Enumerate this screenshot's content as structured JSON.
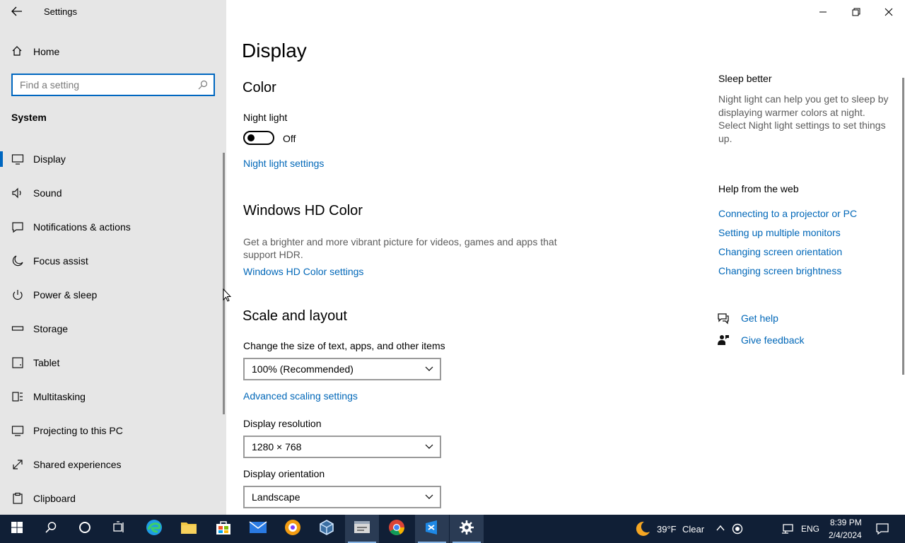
{
  "window": {
    "title": "Settings",
    "minimize_icon": "minimize-icon",
    "maximize_icon": "restore-icon",
    "close_icon": "close-icon"
  },
  "sidebar": {
    "home_label": "Home",
    "search_placeholder": "Find a setting",
    "section": "System",
    "items": [
      {
        "label": "Display",
        "icon": "monitor-icon",
        "selected": true
      },
      {
        "label": "Sound",
        "icon": "speaker-icon"
      },
      {
        "label": "Notifications & actions",
        "icon": "notification-icon"
      },
      {
        "label": "Focus assist",
        "icon": "moon-icon"
      },
      {
        "label": "Power & sleep",
        "icon": "power-icon"
      },
      {
        "label": "Storage",
        "icon": "storage-icon"
      },
      {
        "label": "Tablet",
        "icon": "tablet-icon"
      },
      {
        "label": "Multitasking",
        "icon": "multitasking-icon"
      },
      {
        "label": "Projecting to this PC",
        "icon": "projecting-icon"
      },
      {
        "label": "Shared experiences",
        "icon": "shared-icon"
      },
      {
        "label": "Clipboard",
        "icon": "clipboard-icon"
      }
    ]
  },
  "main": {
    "page_title": "Display",
    "color": {
      "heading": "Color",
      "night_light_label": "Night light",
      "night_light_state": "Off",
      "night_light_settings_link": "Night light settings"
    },
    "hd_color": {
      "heading": "Windows HD Color",
      "description": "Get a brighter and more vibrant picture for videos, games and apps that support HDR.",
      "settings_link": "Windows HD Color settings"
    },
    "scale_layout": {
      "heading": "Scale and layout",
      "size_label": "Change the size of text, apps, and other items",
      "size_value": "100% (Recommended)",
      "advanced_link": "Advanced scaling settings",
      "resolution_label": "Display resolution",
      "resolution_value": "1280 × 768",
      "orientation_label": "Display orientation",
      "orientation_value": "Landscape"
    }
  },
  "right_panel": {
    "sleep_heading": "Sleep better",
    "sleep_text": "Night light can help you get to sleep by displaying warmer colors at night. Select Night light settings to set things up.",
    "help_heading": "Help from the web",
    "help_links": [
      "Connecting to a projector or PC",
      "Setting up multiple monitors",
      "Changing screen orientation",
      "Changing screen brightness"
    ],
    "get_help": "Get help",
    "give_feedback": "Give feedback"
  },
  "taskbar": {
    "weather_temp": "39°F",
    "weather_text": "Clear",
    "language": "ENG",
    "time": "8:39 PM",
    "date": "2/4/2024"
  },
  "colors": {
    "accent": "#0067c0",
    "link": "#0067b8",
    "sidebar_bg": "#e6e6e6",
    "taskbar_bg": "#101f36"
  }
}
